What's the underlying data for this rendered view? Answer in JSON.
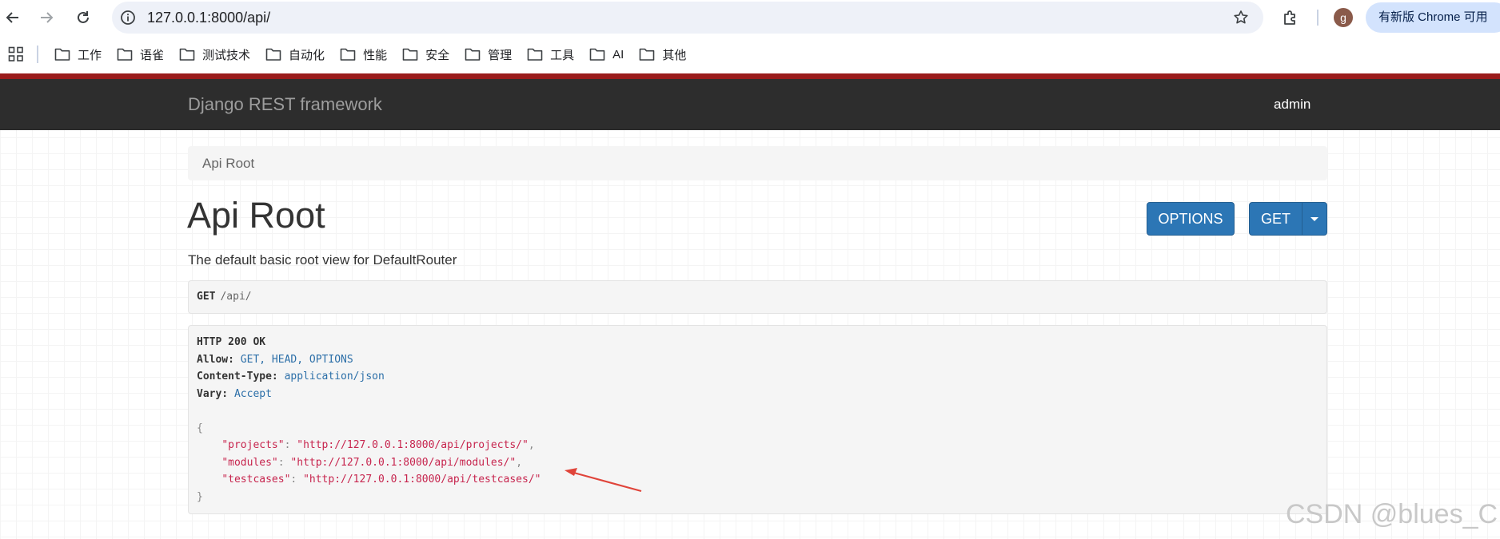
{
  "browser": {
    "url": "127.0.0.1:8000/api/",
    "avatar_letter": "g",
    "update_label": "有新版 Chrome 可用",
    "bookmarks": [
      "工作",
      "语雀",
      "测试技术",
      "自动化",
      "性能",
      "安全",
      "管理",
      "工具",
      "AI",
      "其他"
    ]
  },
  "drf": {
    "brand": "Django REST framework",
    "user": "admin",
    "breadcrumb": "Api Root",
    "title": "Api Root",
    "description": "The default basic root view for DefaultRouter",
    "buttons": {
      "options": "OPTIONS",
      "get": "GET"
    },
    "request": {
      "method": "GET",
      "path": "/api/"
    },
    "response": {
      "status": "HTTP 200 OK",
      "headers": [
        {
          "key": "Allow:",
          "value": "GET, HEAD, OPTIONS"
        },
        {
          "key": "Content-Type:",
          "value": "application/json"
        },
        {
          "key": "Vary:",
          "value": "Accept"
        }
      ],
      "open_brace": "{",
      "close_brace": "}",
      "body": [
        {
          "key": "\"projects\"",
          "value": "\"http://127.0.0.1:8000/api/projects/\"",
          "trail": ","
        },
        {
          "key": "\"modules\"",
          "value": "\"http://127.0.0.1:8000/api/modules/\"",
          "trail": ","
        },
        {
          "key": "\"testcases\"",
          "value": "\"http://127.0.0.1:8000/api/testcases/\"",
          "trail": ""
        }
      ]
    }
  },
  "watermark": "CSDN @blues_C",
  "colors": {
    "navbar": "#2d2d2d",
    "accent_strip": "#9a1b1b",
    "button": "#2c76b5",
    "json_string": "#c7254e",
    "header_value": "#2c6fa8",
    "annotation_arrow": "#e0443a"
  }
}
